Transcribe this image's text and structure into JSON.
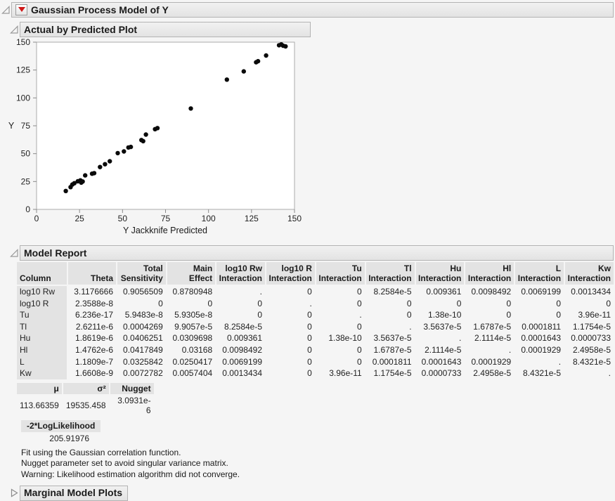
{
  "outline": {
    "root_title": "Gaussian Process Model of Y",
    "plot_section_title": "Actual by Predicted Plot",
    "model_report_title": "Model Report",
    "marginal_title": "Marginal Model Plots"
  },
  "colors": {
    "accent_red": "#d01818",
    "titlebar_bg": "#e9e9e9",
    "header_cell_bg": "#e3e3e3",
    "point_color": "#0a0a0a"
  },
  "chart_data": {
    "type": "scatter",
    "title": "Actual by Predicted Plot",
    "xlabel": "Y Jackknife Predicted",
    "ylabel": "Y",
    "xlim": [
      0,
      150
    ],
    "ylim": [
      0,
      150
    ],
    "xticks": [
      0,
      25,
      50,
      75,
      100,
      125,
      150
    ],
    "yticks": [
      0,
      25,
      50,
      75,
      100,
      125,
      150
    ],
    "grid": false,
    "legend": "none",
    "points": [
      [
        17,
        16.5
      ],
      [
        19.8,
        20
      ],
      [
        20.8,
        22.3
      ],
      [
        22,
        23.5
      ],
      [
        24,
        25.2
      ],
      [
        25.5,
        26
      ],
      [
        26,
        24
      ],
      [
        26.8,
        25
      ],
      [
        28.3,
        30.5
      ],
      [
        32.3,
        32
      ],
      [
        33.5,
        32.5
      ],
      [
        36.9,
        38
      ],
      [
        39.8,
        40.5
      ],
      [
        42.6,
        43.2
      ],
      [
        47.2,
        50.5
      ],
      [
        50.8,
        52
      ],
      [
        53.4,
        55.5
      ],
      [
        54.8,
        56
      ],
      [
        61,
        62.2
      ],
      [
        62,
        61.2
      ],
      [
        63.6,
        67.1
      ],
      [
        68.9,
        72
      ],
      [
        70.3,
        72.9
      ],
      [
        89.7,
        90.5
      ],
      [
        110.7,
        116.4
      ],
      [
        120.5,
        123.8
      ],
      [
        127.7,
        132
      ],
      [
        128.8,
        132.9
      ],
      [
        133.5,
        138
      ],
      [
        141,
        147.2
      ],
      [
        142.3,
        148
      ],
      [
        143.4,
        146.8
      ],
      [
        144.8,
        146.2
      ]
    ]
  },
  "model_report": {
    "columns": [
      "Column",
      "Theta",
      "Total\nSensitivity",
      "Main Effect",
      "log10 Rw\nInteraction",
      "log10 R\nInteraction",
      "Tu\nInteraction",
      "Tl\nInteraction",
      "Hu\nInteraction",
      "Hl\nInteraction",
      "L Interaction",
      "Kw\nInteraction"
    ],
    "rows": [
      [
        "log10 Rw",
        "3.1176666",
        "0.9056509",
        "0.8780948",
        ".",
        "0",
        "0",
        "8.2584e-5",
        "0.009361",
        "0.0098492",
        "0.0069199",
        "0.0013434"
      ],
      [
        "log10 R",
        "2.3588e-8",
        "0",
        "0",
        "0",
        ".",
        "0",
        "0",
        "0",
        "0",
        "0",
        "0"
      ],
      [
        "Tu",
        "6.236e-17",
        "5.9483e-8",
        "5.9305e-8",
        "0",
        "0",
        ".",
        "0",
        "1.38e-10",
        "0",
        "0",
        "3.96e-11"
      ],
      [
        "Tl",
        "2.6211e-6",
        "0.0004269",
        "9.9057e-5",
        "8.2584e-5",
        "0",
        "0",
        ".",
        "3.5637e-5",
        "1.6787e-5",
        "0.0001811",
        "1.1754e-5"
      ],
      [
        "Hu",
        "1.8619e-6",
        "0.0406251",
        "0.0309698",
        "0.009361",
        "0",
        "1.38e-10",
        "3.5637e-5",
        ".",
        "2.1114e-5",
        "0.0001643",
        "0.0000733"
      ],
      [
        "Hl",
        "1.4762e-6",
        "0.0417849",
        "0.03168",
        "0.0098492",
        "0",
        "0",
        "1.6787e-5",
        "2.1114e-5",
        ".",
        "0.0001929",
        "2.4958e-5"
      ],
      [
        "L",
        "1.1809e-7",
        "0.0325842",
        "0.0250417",
        "0.0069199",
        "0",
        "0",
        "0.0001811",
        "0.0001643",
        "0.0001929",
        ".",
        "8.4321e-5"
      ],
      [
        "Kw",
        "1.6608e-9",
        "0.0072782",
        "0.0057404",
        "0.0013434",
        "0",
        "3.96e-11",
        "1.1754e-5",
        "0.0000733",
        "2.4958e-5",
        "8.4321e-5",
        "."
      ]
    ],
    "params": {
      "headers": [
        "μ",
        "σ²",
        "Nugget"
      ],
      "values": [
        "113.66359",
        "19535.458",
        "3.0931e-6"
      ]
    },
    "loglik": {
      "header": "-2*LogLikelihood",
      "value": "205.91976"
    },
    "notes": [
      "Fit using the Gaussian correlation function.",
      "Nugget parameter set to avoid singular variance matrix.",
      "Warning: Likelihood estimation algorithm did not converge."
    ]
  }
}
